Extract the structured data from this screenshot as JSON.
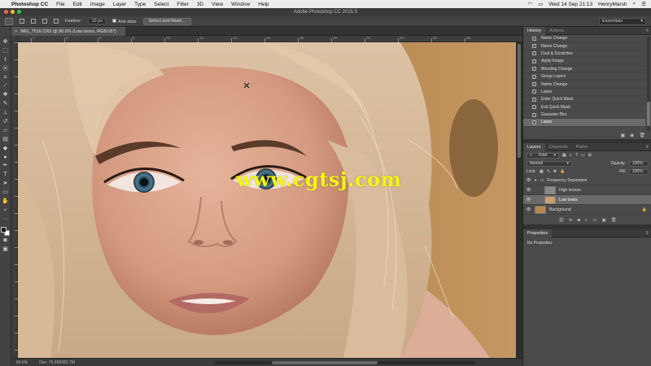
{
  "menubar": {
    "app_name": "Photoshop CC",
    "items": [
      "File",
      "Edit",
      "Image",
      "Layer",
      "Type",
      "Select",
      "Filter",
      "3D",
      "View",
      "Window",
      "Help"
    ],
    "clock": "Wed 14 Sep  21:13",
    "user": "HenryMarsh"
  },
  "window": {
    "title": "Adobe Photoshop CC 2015.5"
  },
  "options": {
    "feather_label": "Feather:",
    "feather_value": "10 px",
    "anti_alias_label": "Anti-alias",
    "select_mask_button": "Select and Mask...",
    "workspace": "Essentials"
  },
  "document": {
    "tab_title": "IMG_7516.CR2 @ 80.6% (Low tones, RGB/16*)",
    "zoom": "80.6%",
    "doc_info": "Doc: 70.6M/282.7M"
  },
  "rulers": {
    "top": [
      "2",
      "4",
      "6",
      "8",
      "10",
      "12",
      "14",
      "16",
      "18",
      "20",
      "22",
      "24",
      "26",
      "28"
    ]
  },
  "history": {
    "tabs": [
      "History",
      "Actions"
    ],
    "items": [
      "Name Change",
      "Name Change",
      "Dust & Scratches",
      "Apply Image",
      "Blending Change",
      "Group Layers",
      "Name Change",
      "Lasso",
      "Enter Quick Mask",
      "Exit Quick Mask",
      "Gaussian Blur",
      "Lasso"
    ],
    "selected_index": 11
  },
  "layers": {
    "tabs": [
      "Layers",
      "Channels",
      "Paths"
    ],
    "filter_kind": "Kind",
    "blend_mode": "Normal",
    "opacity_label": "Opacity:",
    "opacity_value": "100%",
    "lock_label": "Lock:",
    "fill_label": "Fill:",
    "fill_value": "100%",
    "items": [
      {
        "name": "Frequency Separation",
        "type": "group"
      },
      {
        "name": "High texture",
        "type": "layer"
      },
      {
        "name": "Low tones",
        "type": "layer"
      },
      {
        "name": "Background",
        "type": "layer"
      }
    ],
    "selected_index": 2
  },
  "properties": {
    "tab": "Properties",
    "message": "No Properties"
  },
  "watermark": {
    "text": "www.cgtsj.com"
  },
  "colors": {
    "ps_panel": "#4a4a4a",
    "ps_dark": "#323232",
    "selection": "#6a6a6a",
    "watermark": "#f5f512"
  }
}
